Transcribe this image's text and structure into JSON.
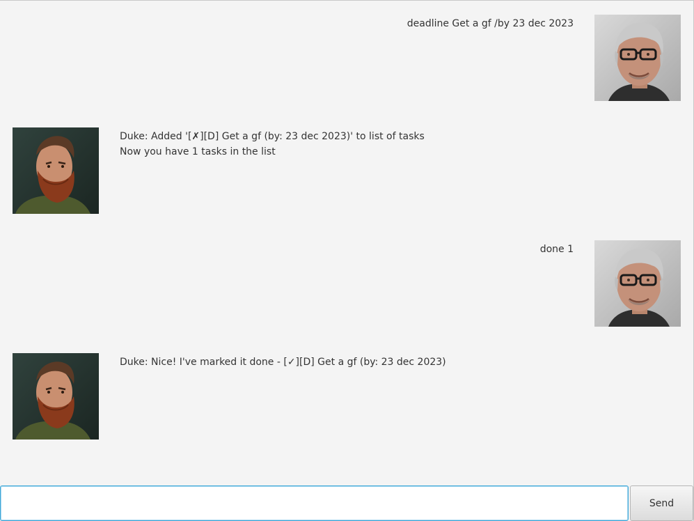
{
  "dialog": {
    "messages": [
      {
        "sender": "user",
        "text": "deadline Get a gf /by 23 dec 2023",
        "avatar": "user-avatar-glasses-man"
      },
      {
        "sender": "duke",
        "text": "Duke: Added '[✗][D] Get a gf (by: 23 dec 2023)' to list of tasks\nNow you have 1 tasks in the list",
        "avatar": "duke-avatar-bearded-man"
      },
      {
        "sender": "user",
        "text": "done 1",
        "avatar": "user-avatar-glasses-man"
      },
      {
        "sender": "duke",
        "text": "Duke: Nice! I've marked it done - [✓][D] Get a gf (by: 23 dec 2023)",
        "avatar": "duke-avatar-bearded-man"
      }
    ]
  },
  "input": {
    "value": "",
    "placeholder": ""
  },
  "send_button": {
    "label": "Send"
  },
  "colors": {
    "background": "#f4f4f4",
    "text": "#333333",
    "input_focus_border": "#3ea7d8"
  }
}
